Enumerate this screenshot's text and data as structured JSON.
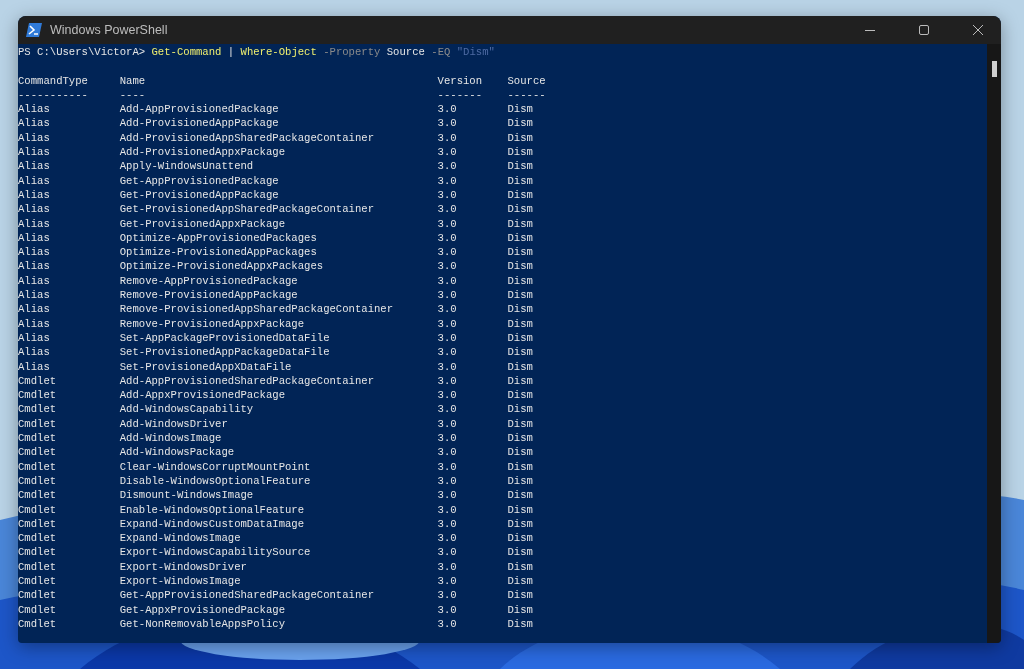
{
  "window": {
    "title": "Windows PowerShell"
  },
  "prompt": [
    {
      "text": "PS C:\\Users\\VictorA> ",
      "kind": "plain"
    },
    {
      "text": "Get-Command",
      "kind": "command"
    },
    {
      "text": " | ",
      "kind": "plain"
    },
    {
      "text": "Where-Object",
      "kind": "command"
    },
    {
      "text": " -Property",
      "kind": "parameter"
    },
    {
      "text": " Source",
      "kind": "plain"
    },
    {
      "text": " -EQ",
      "kind": "parameter"
    },
    {
      "text": " \"Dism\"",
      "kind": "string"
    }
  ],
  "table": {
    "columns": [
      "CommandType",
      "Name",
      "Version",
      "Source"
    ],
    "underlines": [
      "-----------",
      "----",
      "-------",
      "------"
    ],
    "rows": [
      [
        "Alias",
        "Add-AppProvisionedPackage",
        "3.0",
        "Dism"
      ],
      [
        "Alias",
        "Add-ProvisionedAppPackage",
        "3.0",
        "Dism"
      ],
      [
        "Alias",
        "Add-ProvisionedAppSharedPackageContainer",
        "3.0",
        "Dism"
      ],
      [
        "Alias",
        "Add-ProvisionedAppxPackage",
        "3.0",
        "Dism"
      ],
      [
        "Alias",
        "Apply-WindowsUnattend",
        "3.0",
        "Dism"
      ],
      [
        "Alias",
        "Get-AppProvisionedPackage",
        "3.0",
        "Dism"
      ],
      [
        "Alias",
        "Get-ProvisionedAppPackage",
        "3.0",
        "Dism"
      ],
      [
        "Alias",
        "Get-ProvisionedAppSharedPackageContainer",
        "3.0",
        "Dism"
      ],
      [
        "Alias",
        "Get-ProvisionedAppxPackage",
        "3.0",
        "Dism"
      ],
      [
        "Alias",
        "Optimize-AppProvisionedPackages",
        "3.0",
        "Dism"
      ],
      [
        "Alias",
        "Optimize-ProvisionedAppPackages",
        "3.0",
        "Dism"
      ],
      [
        "Alias",
        "Optimize-ProvisionedAppxPackages",
        "3.0",
        "Dism"
      ],
      [
        "Alias",
        "Remove-AppProvisionedPackage",
        "3.0",
        "Dism"
      ],
      [
        "Alias",
        "Remove-ProvisionedAppPackage",
        "3.0",
        "Dism"
      ],
      [
        "Alias",
        "Remove-ProvisionedAppSharedPackageContainer",
        "3.0",
        "Dism"
      ],
      [
        "Alias",
        "Remove-ProvisionedAppxPackage",
        "3.0",
        "Dism"
      ],
      [
        "Alias",
        "Set-AppPackageProvisionedDataFile",
        "3.0",
        "Dism"
      ],
      [
        "Alias",
        "Set-ProvisionedAppPackageDataFile",
        "3.0",
        "Dism"
      ],
      [
        "Alias",
        "Set-ProvisionedAppXDataFile",
        "3.0",
        "Dism"
      ],
      [
        "Cmdlet",
        "Add-AppProvisionedSharedPackageContainer",
        "3.0",
        "Dism"
      ],
      [
        "Cmdlet",
        "Add-AppxProvisionedPackage",
        "3.0",
        "Dism"
      ],
      [
        "Cmdlet",
        "Add-WindowsCapability",
        "3.0",
        "Dism"
      ],
      [
        "Cmdlet",
        "Add-WindowsDriver",
        "3.0",
        "Dism"
      ],
      [
        "Cmdlet",
        "Add-WindowsImage",
        "3.0",
        "Dism"
      ],
      [
        "Cmdlet",
        "Add-WindowsPackage",
        "3.0",
        "Dism"
      ],
      [
        "Cmdlet",
        "Clear-WindowsCorruptMountPoint",
        "3.0",
        "Dism"
      ],
      [
        "Cmdlet",
        "Disable-WindowsOptionalFeature",
        "3.0",
        "Dism"
      ],
      [
        "Cmdlet",
        "Dismount-WindowsImage",
        "3.0",
        "Dism"
      ],
      [
        "Cmdlet",
        "Enable-WindowsOptionalFeature",
        "3.0",
        "Dism"
      ],
      [
        "Cmdlet",
        "Expand-WindowsCustomDataImage",
        "3.0",
        "Dism"
      ],
      [
        "Cmdlet",
        "Expand-WindowsImage",
        "3.0",
        "Dism"
      ],
      [
        "Cmdlet",
        "Export-WindowsCapabilitySource",
        "3.0",
        "Dism"
      ],
      [
        "Cmdlet",
        "Export-WindowsDriver",
        "3.0",
        "Dism"
      ],
      [
        "Cmdlet",
        "Export-WindowsImage",
        "3.0",
        "Dism"
      ],
      [
        "Cmdlet",
        "Get-AppProvisionedSharedPackageContainer",
        "3.0",
        "Dism"
      ],
      [
        "Cmdlet",
        "Get-AppxProvisionedPackage",
        "3.0",
        "Dism"
      ],
      [
        "Cmdlet",
        "Get-NonRemovableAppsPolicy",
        "3.0",
        "Dism"
      ]
    ]
  }
}
